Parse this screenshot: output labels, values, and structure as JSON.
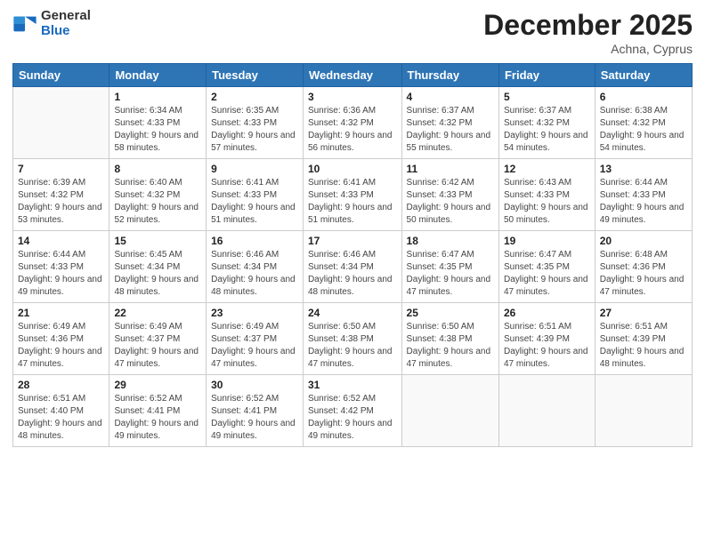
{
  "header": {
    "logo_general": "General",
    "logo_blue": "Blue",
    "title": "December 2025",
    "location": "Achna, Cyprus"
  },
  "days_of_week": [
    "Sunday",
    "Monday",
    "Tuesday",
    "Wednesday",
    "Thursday",
    "Friday",
    "Saturday"
  ],
  "weeks": [
    [
      {
        "day": "",
        "sunrise": "",
        "sunset": "",
        "daylight": ""
      },
      {
        "day": "1",
        "sunrise": "Sunrise: 6:34 AM",
        "sunset": "Sunset: 4:33 PM",
        "daylight": "Daylight: 9 hours and 58 minutes."
      },
      {
        "day": "2",
        "sunrise": "Sunrise: 6:35 AM",
        "sunset": "Sunset: 4:33 PM",
        "daylight": "Daylight: 9 hours and 57 minutes."
      },
      {
        "day": "3",
        "sunrise": "Sunrise: 6:36 AM",
        "sunset": "Sunset: 4:32 PM",
        "daylight": "Daylight: 9 hours and 56 minutes."
      },
      {
        "day": "4",
        "sunrise": "Sunrise: 6:37 AM",
        "sunset": "Sunset: 4:32 PM",
        "daylight": "Daylight: 9 hours and 55 minutes."
      },
      {
        "day": "5",
        "sunrise": "Sunrise: 6:37 AM",
        "sunset": "Sunset: 4:32 PM",
        "daylight": "Daylight: 9 hours and 54 minutes."
      },
      {
        "day": "6",
        "sunrise": "Sunrise: 6:38 AM",
        "sunset": "Sunset: 4:32 PM",
        "daylight": "Daylight: 9 hours and 54 minutes."
      }
    ],
    [
      {
        "day": "7",
        "sunrise": "Sunrise: 6:39 AM",
        "sunset": "Sunset: 4:32 PM",
        "daylight": "Daylight: 9 hours and 53 minutes."
      },
      {
        "day": "8",
        "sunrise": "Sunrise: 6:40 AM",
        "sunset": "Sunset: 4:32 PM",
        "daylight": "Daylight: 9 hours and 52 minutes."
      },
      {
        "day": "9",
        "sunrise": "Sunrise: 6:41 AM",
        "sunset": "Sunset: 4:33 PM",
        "daylight": "Daylight: 9 hours and 51 minutes."
      },
      {
        "day": "10",
        "sunrise": "Sunrise: 6:41 AM",
        "sunset": "Sunset: 4:33 PM",
        "daylight": "Daylight: 9 hours and 51 minutes."
      },
      {
        "day": "11",
        "sunrise": "Sunrise: 6:42 AM",
        "sunset": "Sunset: 4:33 PM",
        "daylight": "Daylight: 9 hours and 50 minutes."
      },
      {
        "day": "12",
        "sunrise": "Sunrise: 6:43 AM",
        "sunset": "Sunset: 4:33 PM",
        "daylight": "Daylight: 9 hours and 50 minutes."
      },
      {
        "day": "13",
        "sunrise": "Sunrise: 6:44 AM",
        "sunset": "Sunset: 4:33 PM",
        "daylight": "Daylight: 9 hours and 49 minutes."
      }
    ],
    [
      {
        "day": "14",
        "sunrise": "Sunrise: 6:44 AM",
        "sunset": "Sunset: 4:33 PM",
        "daylight": "Daylight: 9 hours and 49 minutes."
      },
      {
        "day": "15",
        "sunrise": "Sunrise: 6:45 AM",
        "sunset": "Sunset: 4:34 PM",
        "daylight": "Daylight: 9 hours and 48 minutes."
      },
      {
        "day": "16",
        "sunrise": "Sunrise: 6:46 AM",
        "sunset": "Sunset: 4:34 PM",
        "daylight": "Daylight: 9 hours and 48 minutes."
      },
      {
        "day": "17",
        "sunrise": "Sunrise: 6:46 AM",
        "sunset": "Sunset: 4:34 PM",
        "daylight": "Daylight: 9 hours and 48 minutes."
      },
      {
        "day": "18",
        "sunrise": "Sunrise: 6:47 AM",
        "sunset": "Sunset: 4:35 PM",
        "daylight": "Daylight: 9 hours and 47 minutes."
      },
      {
        "day": "19",
        "sunrise": "Sunrise: 6:47 AM",
        "sunset": "Sunset: 4:35 PM",
        "daylight": "Daylight: 9 hours and 47 minutes."
      },
      {
        "day": "20",
        "sunrise": "Sunrise: 6:48 AM",
        "sunset": "Sunset: 4:36 PM",
        "daylight": "Daylight: 9 hours and 47 minutes."
      }
    ],
    [
      {
        "day": "21",
        "sunrise": "Sunrise: 6:49 AM",
        "sunset": "Sunset: 4:36 PM",
        "daylight": "Daylight: 9 hours and 47 minutes."
      },
      {
        "day": "22",
        "sunrise": "Sunrise: 6:49 AM",
        "sunset": "Sunset: 4:37 PM",
        "daylight": "Daylight: 9 hours and 47 minutes."
      },
      {
        "day": "23",
        "sunrise": "Sunrise: 6:49 AM",
        "sunset": "Sunset: 4:37 PM",
        "daylight": "Daylight: 9 hours and 47 minutes."
      },
      {
        "day": "24",
        "sunrise": "Sunrise: 6:50 AM",
        "sunset": "Sunset: 4:38 PM",
        "daylight": "Daylight: 9 hours and 47 minutes."
      },
      {
        "day": "25",
        "sunrise": "Sunrise: 6:50 AM",
        "sunset": "Sunset: 4:38 PM",
        "daylight": "Daylight: 9 hours and 47 minutes."
      },
      {
        "day": "26",
        "sunrise": "Sunrise: 6:51 AM",
        "sunset": "Sunset: 4:39 PM",
        "daylight": "Daylight: 9 hours and 47 minutes."
      },
      {
        "day": "27",
        "sunrise": "Sunrise: 6:51 AM",
        "sunset": "Sunset: 4:39 PM",
        "daylight": "Daylight: 9 hours and 48 minutes."
      }
    ],
    [
      {
        "day": "28",
        "sunrise": "Sunrise: 6:51 AM",
        "sunset": "Sunset: 4:40 PM",
        "daylight": "Daylight: 9 hours and 48 minutes."
      },
      {
        "day": "29",
        "sunrise": "Sunrise: 6:52 AM",
        "sunset": "Sunset: 4:41 PM",
        "daylight": "Daylight: 9 hours and 49 minutes."
      },
      {
        "day": "30",
        "sunrise": "Sunrise: 6:52 AM",
        "sunset": "Sunset: 4:41 PM",
        "daylight": "Daylight: 9 hours and 49 minutes."
      },
      {
        "day": "31",
        "sunrise": "Sunrise: 6:52 AM",
        "sunset": "Sunset: 4:42 PM",
        "daylight": "Daylight: 9 hours and 49 minutes."
      },
      {
        "day": "",
        "sunrise": "",
        "sunset": "",
        "daylight": ""
      },
      {
        "day": "",
        "sunrise": "",
        "sunset": "",
        "daylight": ""
      },
      {
        "day": "",
        "sunrise": "",
        "sunset": "",
        "daylight": ""
      }
    ]
  ]
}
